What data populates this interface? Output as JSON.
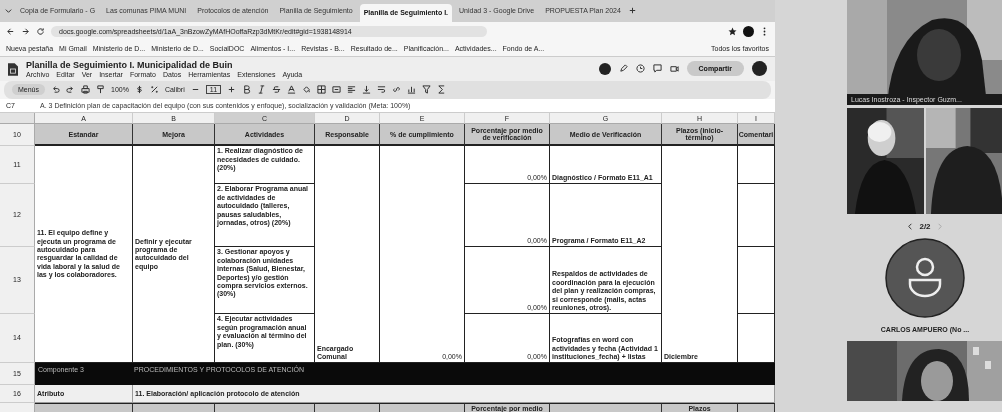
{
  "browser": {
    "tabs": [
      {
        "title": "Copia de Formulario - G",
        "selected": false
      },
      {
        "title": "Las comunas PIMA MUNI",
        "selected": false
      },
      {
        "title": "Protocolos de atención",
        "selected": false
      },
      {
        "title": "Planilla de Seguimiento",
        "selected": false
      },
      {
        "title": "Planilla de Seguimiento I.",
        "selected": true
      },
      {
        "title": "Unidad 3 - Google Drive",
        "selected": false
      },
      {
        "title": "PROPUESTA Plan 2024",
        "selected": false
      }
    ],
    "url": "docs.google.com/spreadsheets/d/1aA_3nBzowZyMAfHOoffaRzp3dMtKr/edit#gid=1938148914",
    "bookmarks": [
      "Nueva pestaña",
      "Mi Gmail",
      "Ministerio de D...",
      "Ministerio de D...",
      "SocialDOC",
      "Alimentos - I...",
      "Revistas - B...",
      "Resultado de...",
      "Planificación...",
      "Actividades...",
      "Fondo de A..."
    ],
    "all_bookmarks": "Todos los favoritos"
  },
  "document": {
    "title": "Planilla de Seguimiento I. Municipalidad de Buin",
    "menus": [
      "Archivo",
      "Editar",
      "Ver",
      "Insertar",
      "Formato",
      "Datos",
      "Herramientas",
      "Extensiones",
      "Ayuda"
    ],
    "share": "Compartir"
  },
  "toolbar": {
    "search": "Menús",
    "zoom": "100%",
    "font": "Calibri",
    "font_size": "11"
  },
  "sheet": {
    "cell_ref": "C7",
    "formula": "A. 3 Definición plan de capacitación del equipo (con sus contenidos y enfoque), socialización y validación (Meta: 100%)",
    "columns": [
      {
        "letter": "A",
        "selected": false
      },
      {
        "letter": "B",
        "selected": false
      },
      {
        "letter": "C",
        "selected": true
      },
      {
        "letter": "D",
        "selected": false
      },
      {
        "letter": "E",
        "selected": false
      },
      {
        "letter": "F",
        "selected": false
      },
      {
        "letter": "G",
        "selected": false
      },
      {
        "letter": "H",
        "selected": false
      },
      {
        "letter": "I",
        "selected": false
      }
    ],
    "header_row": {
      "number": "10",
      "cells": [
        "Estandar",
        "Mejora",
        "Actividades",
        "Responsable",
        "% de cumplimiento",
        "Porcentaje por medio de verificación",
        "Medio de Verificación",
        "Plazos (inicio-término)",
        "Comentari"
      ]
    },
    "block": {
      "row_numbers": [
        "11",
        "12",
        "13",
        "14"
      ],
      "estandar": "11. El equipo define y ejecuta un programa de autocuidado para resguardar la calidad de vida laboral y la salud de las y los colaboradores.",
      "mejora": "Definir y ejecutar programa de autocuidado del equipo",
      "actividades": [
        "1. Realizar diagnóstico de necesidades de cuidado. (20%)",
        "2. Elaborar Programa anual de actividades de autocuidado (talleres, pausas saludables, jornadas, otros) (20%)",
        "3. Gestionar apoyos y colaboración unidades internas (Salud, Bienestar, Deportes) y/o gestión compra servicios externos. (30%)",
        "4. Ejecutar actividades según programación anual y evaluación al término del plan. (30%)"
      ],
      "responsable": "Encargado Comunal",
      "cumplimiento": "0,00%",
      "porcentajes": [
        "0,00%",
        "0,00%",
        "0,00%",
        "0,00%"
      ],
      "medios": [
        "Diagnóstico / Formato E11_A1",
        "Programa / Formato E11_A2",
        "Respaldos de actividades de coordinación para la ejecución del plan y realización compras, si corresponde (mails, actas reuniones, otros).",
        "Fotografías en word con actividades y fecha (Actividad 1 instituciones_fecha) + listas"
      ],
      "plazo": "Diciembre"
    },
    "component_row": {
      "number": "15",
      "label": "Componente 3",
      "title": "PROCEDIMIENTOS Y PROTOCOLOS DE ATENCIÓN"
    },
    "attribute_row": {
      "number": "16",
      "label": "Atributo",
      "value": "11. Elaboración/ aplicación protocolo de atención"
    },
    "next_header_row": {
      "F": "Porcentaje por medio",
      "H": "Plazos"
    }
  },
  "call": {
    "top_tile_name": "Lucas Inostroza - Inspector Guzm...",
    "page": "2/2",
    "participant": "CARLOS AMPUERO (No ..."
  }
}
